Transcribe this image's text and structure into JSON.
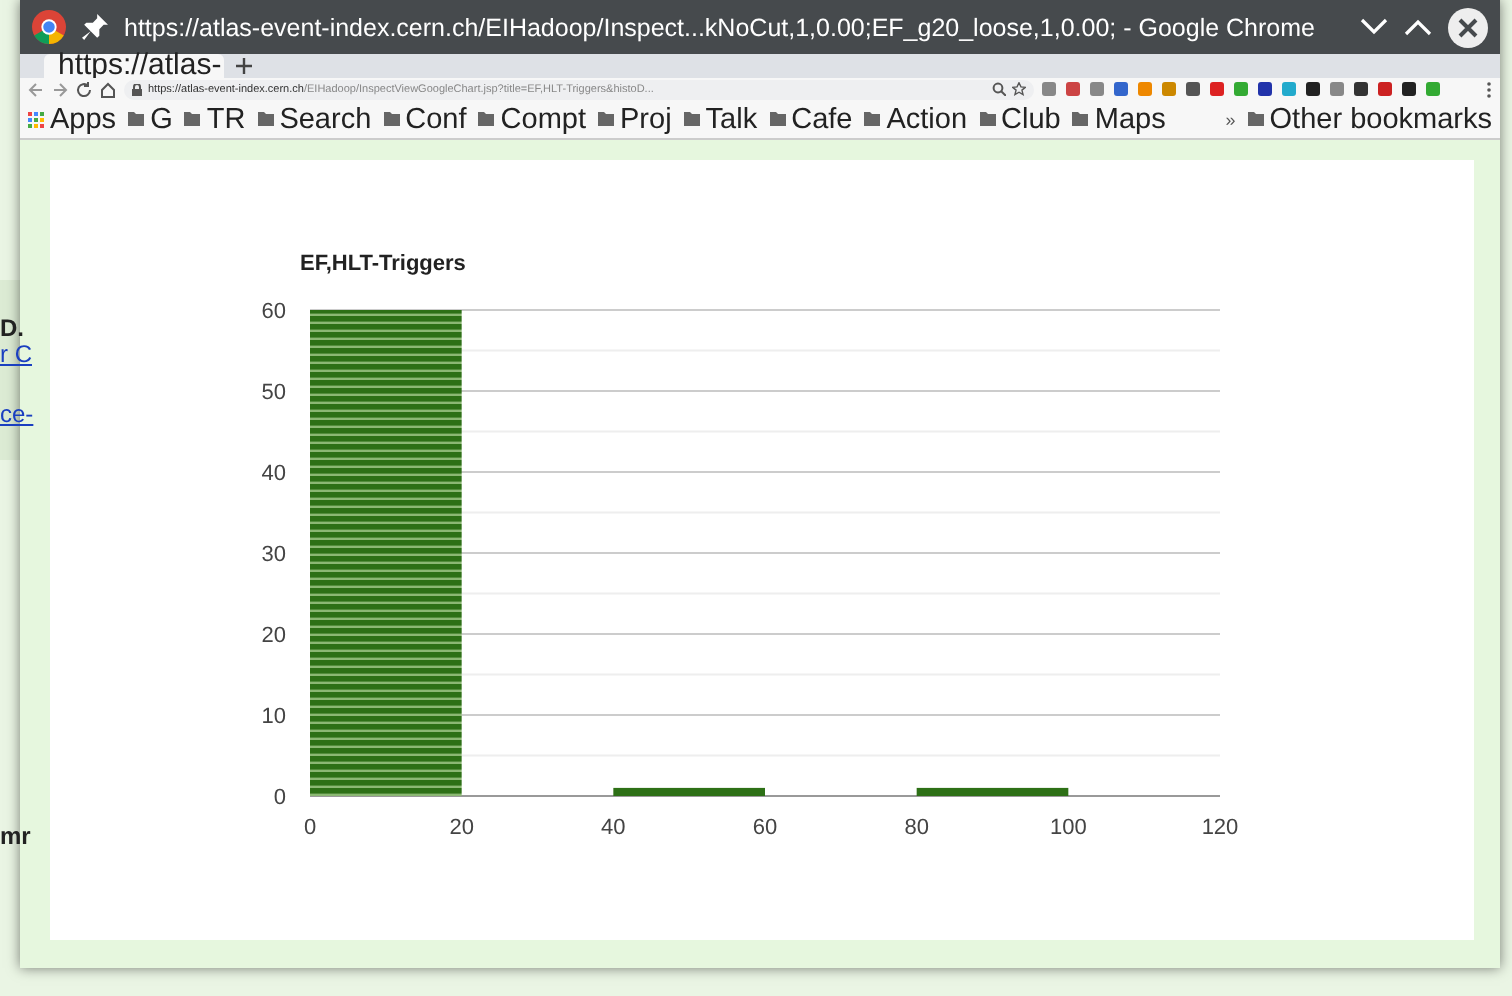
{
  "background_page": {
    "fragments": [
      {
        "text": "D.",
        "kind": "bold"
      },
      {
        "text": "r C",
        "kind": "link"
      },
      {
        "text": "ce-",
        "kind": "link"
      },
      {
        "text": "mr",
        "kind": "bold"
      }
    ]
  },
  "window": {
    "title": "https://atlas-event-index.cern.ch/EIHadoop/Inspect...kNoCut,1,0.00;EF_g20_loose,1,0.00; - Google Chrome"
  },
  "tabs": [
    {
      "label": "https://atlas-",
      "selected": true
    }
  ],
  "address_bar": {
    "host": "https://atlas-event-index.cern.ch",
    "path": "/EIHadoop/InspectViewGoogleChart.jsp?title=EF,HLT-Triggers&histoD..."
  },
  "bookmarks": [
    {
      "label": "Apps",
      "kind": "apps"
    },
    {
      "label": "G",
      "kind": "folder"
    },
    {
      "label": "TR",
      "kind": "folder"
    },
    {
      "label": "Search",
      "kind": "folder"
    },
    {
      "label": "Conf",
      "kind": "folder"
    },
    {
      "label": "Compt",
      "kind": "folder"
    },
    {
      "label": "Proj",
      "kind": "folder"
    },
    {
      "label": "Talk",
      "kind": "folder"
    },
    {
      "label": "Cafe",
      "kind": "folder"
    },
    {
      "label": "Action",
      "kind": "folder"
    },
    {
      "label": "Club",
      "kind": "folder"
    },
    {
      "label": "Maps",
      "kind": "folder"
    }
  ],
  "overflow": "»",
  "other_bookmarks": "Other bookmarks",
  "chart_data": {
    "type": "bar",
    "title": "EF,HLT-Triggers",
    "x": [
      10,
      50,
      90
    ],
    "values": [
      60,
      1,
      1
    ],
    "xlim": [
      0,
      120
    ],
    "ylim": [
      0,
      60
    ],
    "xticks": [
      0,
      20,
      40,
      60,
      80,
      100,
      120
    ],
    "yticks": [
      0,
      10,
      20,
      30,
      40,
      50,
      60
    ],
    "grid": true
  }
}
